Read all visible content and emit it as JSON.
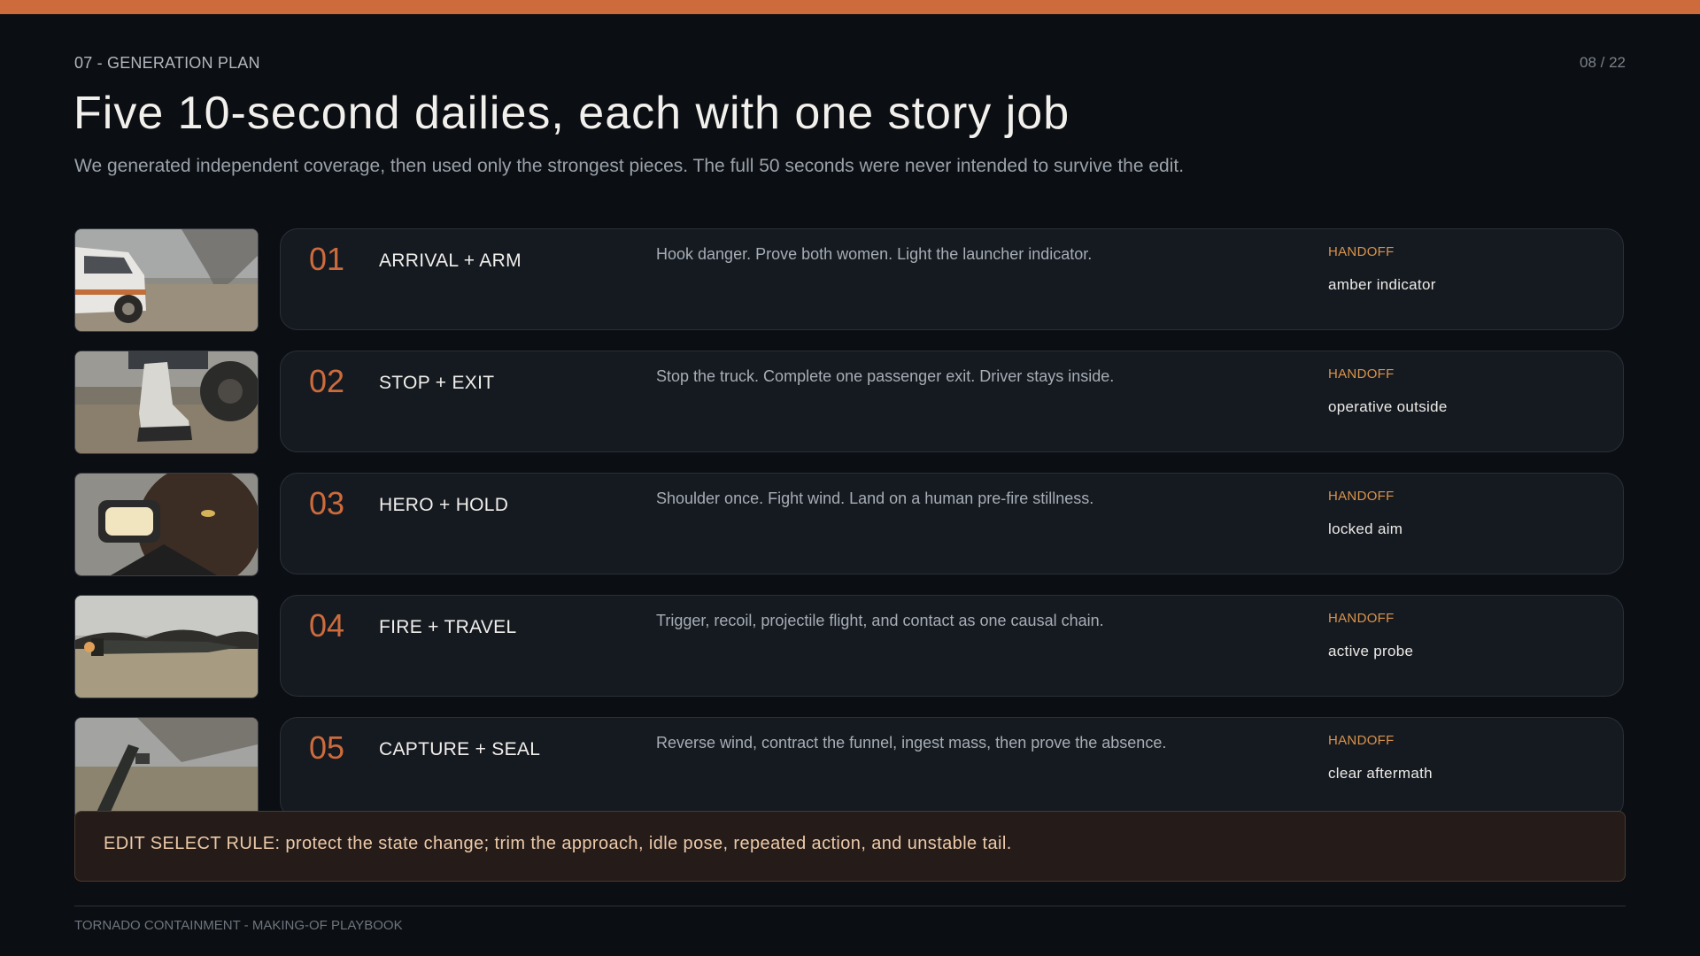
{
  "header": {
    "eyebrow": "07 - GENERATION PLAN",
    "page_indicator": "08 / 22",
    "title": "Five 10-second dailies, each with one story job",
    "subtitle": "We generated independent coverage, then used only the strongest pieces. The full 50 seconds were never intended to survive the edit."
  },
  "dailies": [
    {
      "number": "01",
      "name": "ARRIVAL + ARM",
      "description": "Hook danger. Prove both women. Light the launcher indicator.",
      "handoff_label": "HANDOFF",
      "handoff": "amber indicator",
      "thumb_icon": "truck-tornado-thumbnail"
    },
    {
      "number": "02",
      "name": "STOP + EXIT",
      "description": "Stop the truck. Complete one passenger exit. Driver stays inside.",
      "handoff_label": "HANDOFF",
      "handoff": "operative outside",
      "thumb_icon": "boot-exit-thumbnail"
    },
    {
      "number": "03",
      "name": "HERO + HOLD",
      "description": "Shoulder once. Fight wind. Land on a human pre-fire stillness.",
      "handoff_label": "HANDOFF",
      "handoff": "locked aim",
      "thumb_icon": "aiming-hero-thumbnail"
    },
    {
      "number": "04",
      "name": "FIRE + TRAVEL",
      "description": "Trigger, recoil, projectile flight, and contact as one causal chain.",
      "handoff_label": "HANDOFF",
      "handoff": "active probe",
      "thumb_icon": "projectile-thumbnail"
    },
    {
      "number": "05",
      "name": "CAPTURE + SEAL",
      "description": "Reverse wind, contract the funnel, ingest mass, then prove the absence.",
      "handoff_label": "HANDOFF",
      "handoff": "clear aftermath",
      "thumb_icon": "launcher-capture-thumbnail"
    }
  ],
  "rule": {
    "text": "EDIT SELECT RULE: protect the state change; trim the approach, idle pose, repeated action, and unstable tail."
  },
  "footer": {
    "text": "TORNADO CONTAINMENT - MAKING-OF PLAYBOOK"
  },
  "colors": {
    "accent": "#cd6b3c",
    "handoff_label": "#d9934a",
    "background": "#0b0e12",
    "card": "#151a21"
  }
}
